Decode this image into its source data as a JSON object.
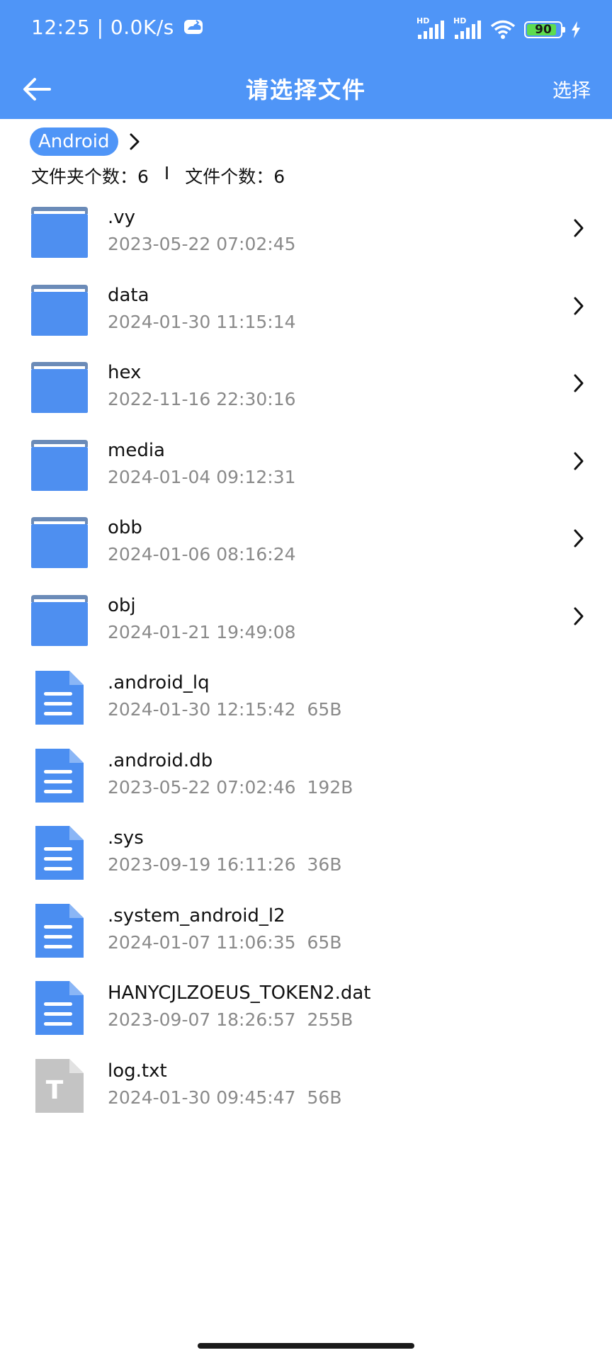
{
  "status_bar": {
    "time_speed": "12:25 | 0.0K/s",
    "signal_1_label": "HD",
    "signal_2_label": "HD",
    "battery": "90",
    "battery_level": 0.9
  },
  "title_bar": {
    "title": "请选择文件",
    "action": "选择"
  },
  "breadcrumb": {
    "current": "Android"
  },
  "counts": {
    "folders": "文件夹个数：6",
    "separator": "I",
    "files": "文件个数：6"
  },
  "folders": [
    {
      "name": ".vy",
      "date": "2023-05-22 07:02:45"
    },
    {
      "name": "data",
      "date": "2024-01-30 11:15:14"
    },
    {
      "name": "hex",
      "date": "2022-11-16 22:30:16"
    },
    {
      "name": "media",
      "date": "2024-01-04 09:12:31"
    },
    {
      "name": "obb",
      "date": "2024-01-06 08:16:24"
    },
    {
      "name": "obj",
      "date": "2024-01-21 19:49:08"
    }
  ],
  "files": [
    {
      "name": ".android_lq",
      "date": "2024-01-30 12:15:42",
      "size": "65B",
      "type": "doc-icon"
    },
    {
      "name": ".android.db",
      "date": "2023-05-22 07:02:46",
      "size": "192B",
      "type": "doc-icon"
    },
    {
      "name": ".sys",
      "date": "2023-09-19 16:11:26",
      "size": "36B",
      "type": "doc-icon"
    },
    {
      "name": ".system_android_l2",
      "date": "2024-01-07 11:06:35",
      "size": "65B",
      "type": "doc-icon"
    },
    {
      "name": "HANYCJLZOEUS_TOKEN2.dat",
      "date": "2023-09-07 18:26:57",
      "size": "255B",
      "type": "doc-icon"
    },
    {
      "name": "log.txt",
      "date": "2024-01-30 09:45:47",
      "size": "56B",
      "type": "text-icon",
      "icon_letter": "T"
    }
  ],
  "colors": {
    "accent": "#4f95f7",
    "folder": "#4e8ff0",
    "folder_tab": "#6b8bb8",
    "doc": "#4b8ef1",
    "text_file": "#c4c4c4"
  }
}
